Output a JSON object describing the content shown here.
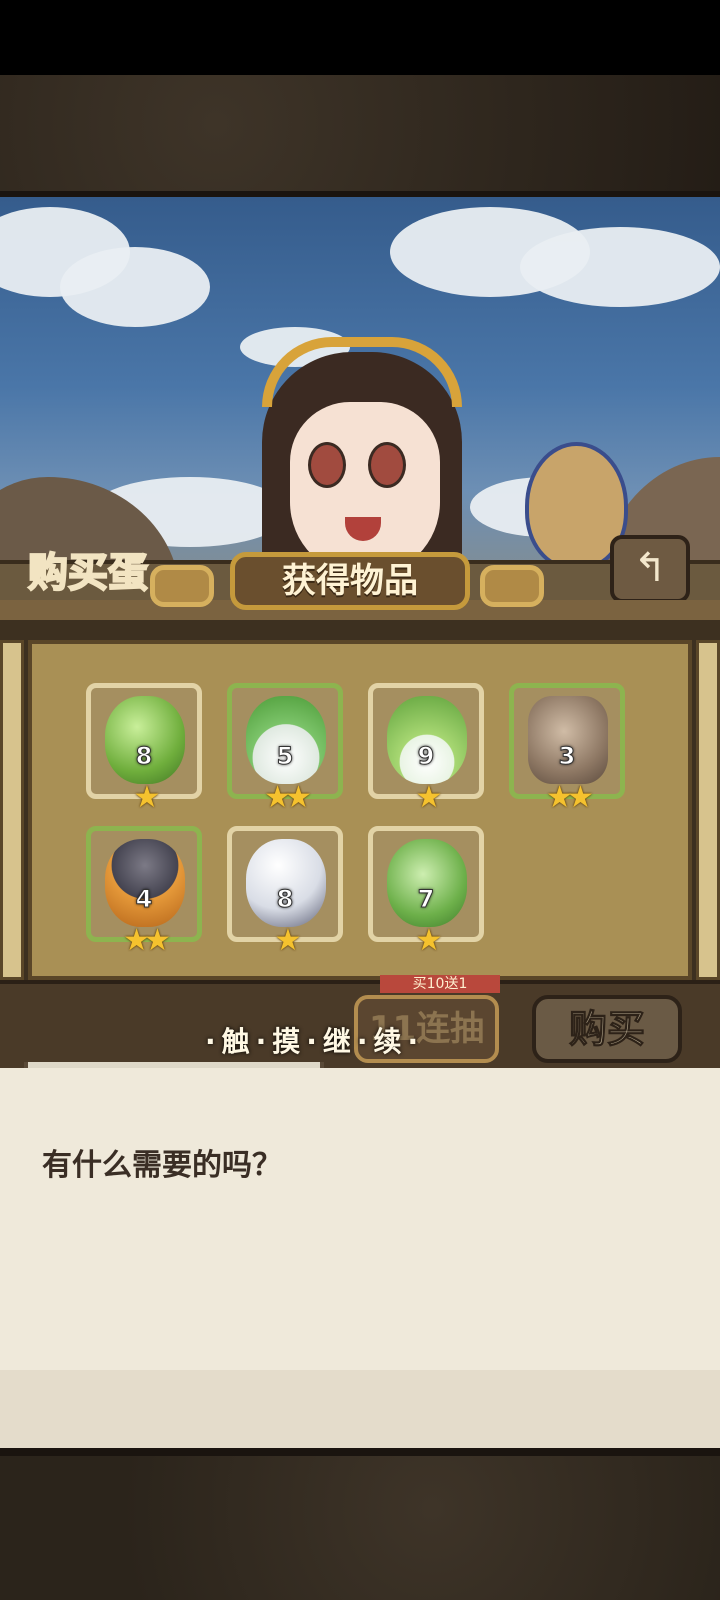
{
  "shop": {
    "title": "购买蛋",
    "back_icon": "back-arrow-icon"
  },
  "dialog": {
    "title": "获得物品",
    "items": [
      {
        "name": "green-slime-egg",
        "count": "8",
        "stars": "★",
        "border": "#e2d3a6"
      },
      {
        "name": "turnip-egg",
        "count": "5",
        "stars": "★★",
        "border": "#8db44f"
      },
      {
        "name": "sprout-bulb-egg",
        "count": "9",
        "stars": "★",
        "border": "#e2d3a6"
      },
      {
        "name": "rock-helmet-egg",
        "count": "3",
        "stars": "★★",
        "border": "#8db44f"
      },
      {
        "name": "hat-egg",
        "count": "4",
        "stars": "★★",
        "border": "#8db44f"
      },
      {
        "name": "white-egg",
        "count": "8",
        "stars": "★",
        "border": "#e2d3a6"
      },
      {
        "name": "leaf-egg",
        "count": "7",
        "stars": "★",
        "border": "#e2d3a6"
      }
    ]
  },
  "controls": {
    "banner": "买10送1",
    "ten_button": "11连抽",
    "buy_button": "购买",
    "continue_hint": "·触·摸·继·续·"
  },
  "message": "有什么需要的吗？"
}
